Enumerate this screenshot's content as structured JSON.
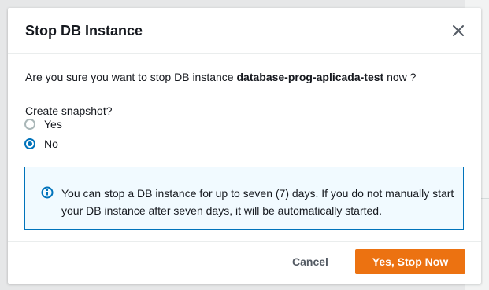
{
  "dialog": {
    "title": "Stop DB Instance",
    "question_prefix": "Are you sure you want to stop DB instance ",
    "instance_name": "database-prog-aplicada-test",
    "question_suffix": " now ?",
    "close_icon": "close-icon"
  },
  "snapshot": {
    "label": "Create snapshot?",
    "options": [
      {
        "label": "Yes",
        "checked": false
      },
      {
        "label": "No",
        "checked": true
      }
    ]
  },
  "info": {
    "icon": "info-icon",
    "text": "You can stop a DB instance for up to seven (7) days. If you do not manually start your DB instance after seven days, it will be automatically started."
  },
  "footer": {
    "cancel_label": "Cancel",
    "confirm_label": "Yes, Stop Now"
  },
  "colors": {
    "primary": "#ec7211",
    "accent": "#0073bb",
    "info_bg": "#f1faff"
  }
}
